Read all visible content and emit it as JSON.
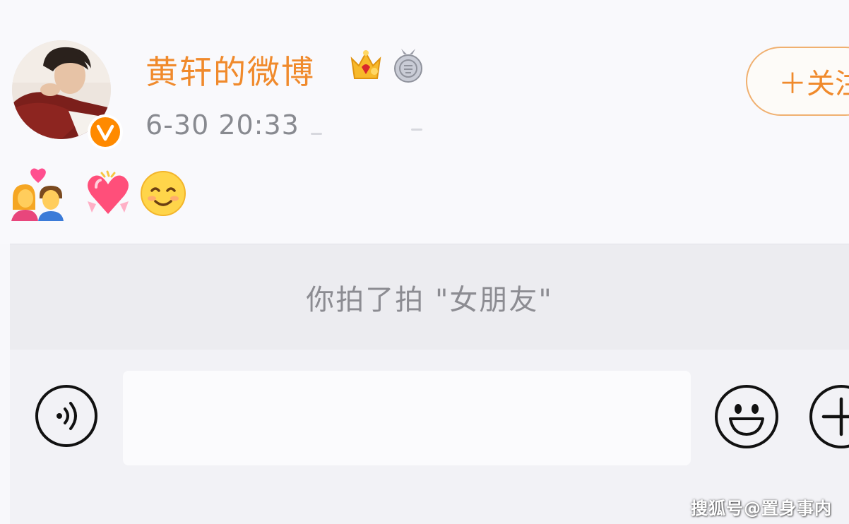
{
  "post": {
    "username": "黄轩的微博",
    "timestamp": "6-30 20:33",
    "follow_label": "＋关注",
    "badges": [
      "crown-vip-icon",
      "silver-medal-icon"
    ],
    "verified_badge": "verified-v-icon",
    "emojis": [
      "kiss-couple-emoji",
      "heart-with-ribbon-emoji",
      "smiling-face-emoji"
    ]
  },
  "notice": {
    "text": "你拍了拍 \"女朋友\""
  },
  "input_bar": {
    "placeholder": "",
    "voice_icon": "voice-icon",
    "emoji_icon": "emoji-icon",
    "more_icon": "plus-icon"
  },
  "watermark": {
    "text": "搜狐号@置身事内"
  },
  "colors": {
    "accent": "#f08a2c",
    "verified": "#ff8a00",
    "notice_bg": "#ececf0",
    "muted_text": "#888a90"
  }
}
